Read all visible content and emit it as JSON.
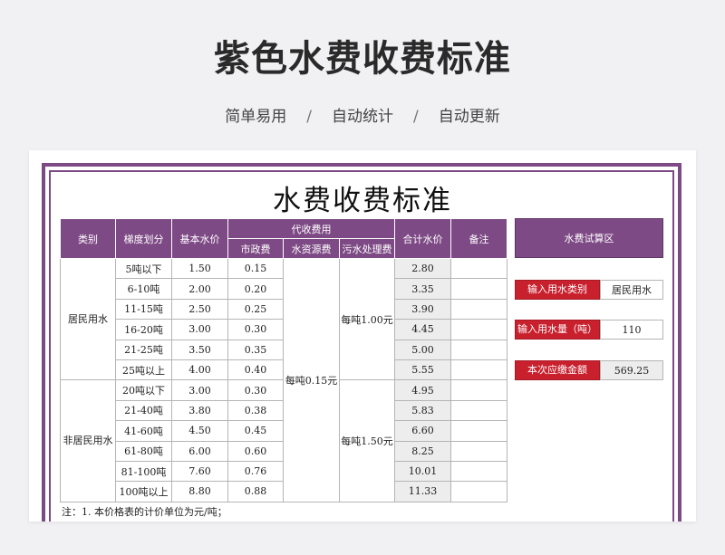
{
  "page": {
    "title": "紫色水费收费标准",
    "tagline": [
      "简单易用",
      "自动统计",
      "自动更新"
    ],
    "separator": "/"
  },
  "sheet": {
    "title": "水费收费标准",
    "headers": {
      "category": "类别",
      "tier": "梯度划分",
      "base_price": "基本水价",
      "collection": "代收费用",
      "municipal": "市政费",
      "water_resource": "水资源费",
      "sewage": "污水处理费",
      "total": "合计水价",
      "remark": "备注"
    },
    "groups": [
      {
        "category": "居民用水",
        "sewage": "每吨1.00元",
        "rows": [
          {
            "tier": "5吨以下",
            "base": "1.50",
            "municipal": "0.15",
            "total": "2.80"
          },
          {
            "tier": "6-10吨",
            "base": "2.00",
            "municipal": "0.20",
            "total": "3.35"
          },
          {
            "tier": "11-15吨",
            "base": "2.50",
            "municipal": "0.25",
            "total": "3.90"
          },
          {
            "tier": "16-20吨",
            "base": "3.00",
            "municipal": "0.30",
            "total": "4.45"
          },
          {
            "tier": "21-25吨",
            "base": "3.50",
            "municipal": "0.35",
            "total": "5.00"
          },
          {
            "tier": "25吨以上",
            "base": "4.00",
            "municipal": "0.40",
            "total": "5.55"
          }
        ]
      },
      {
        "category": "非居民用水",
        "sewage": "每吨1.50元",
        "rows": [
          {
            "tier": "20吨以下",
            "base": "3.00",
            "municipal": "0.30",
            "total": "4.95"
          },
          {
            "tier": "21-40吨",
            "base": "3.80",
            "municipal": "0.38",
            "total": "5.83"
          },
          {
            "tier": "41-60吨",
            "base": "4.50",
            "municipal": "0.45",
            "total": "6.60"
          },
          {
            "tier": "61-80吨",
            "base": "6.00",
            "municipal": "0.60",
            "total": "8.25"
          },
          {
            "tier": "81-100吨",
            "base": "7.60",
            "municipal": "0.76",
            "total": "10.01"
          },
          {
            "tier": "100吨以上",
            "base": "8.80",
            "municipal": "0.88",
            "total": "11.33"
          }
        ]
      }
    ],
    "water_resource_fee": "每吨0.15元",
    "note": "注：1. 本价格表的计价单位为元/吨；"
  },
  "calculator": {
    "title": "水费试算区",
    "type_label": "输入用水类别",
    "type_value": "居民用水",
    "amount_label": "输入用水量（吨）",
    "amount_value": "110",
    "fee_label": "本次应缴金额",
    "fee_value": "569.25"
  },
  "colors": {
    "accent_purple": "#7e4a85",
    "accent_red": "#c8202d",
    "total_bg": "#ededed"
  }
}
